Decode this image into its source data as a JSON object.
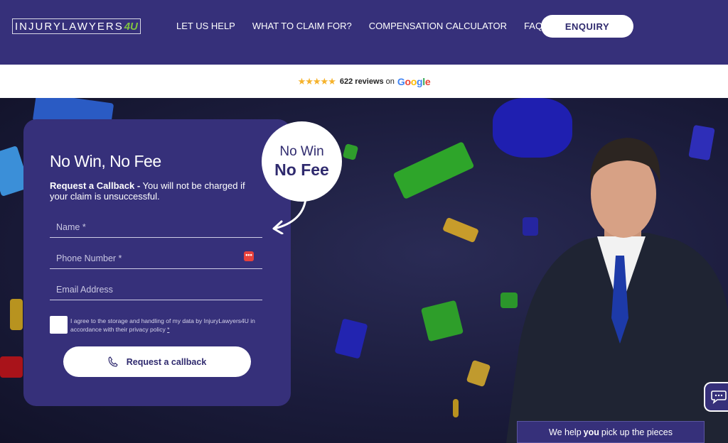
{
  "header": {
    "logo_text": "INJURYLAWYERS",
    "logo_suffix": "4U",
    "nav": [
      "LET US HELP",
      "WHAT TO CLAIM FOR?",
      "COMPENSATION CALCULATOR",
      "FAQ"
    ],
    "enquiry_label": "ENQUIRY"
  },
  "reviews": {
    "stars": "★★★★★",
    "count_text": "622 reviews",
    "on_text": "on",
    "google": [
      "G",
      "o",
      "o",
      "g",
      "l",
      "e"
    ]
  },
  "form": {
    "title": "No Win, No Fee",
    "subtitle_bold": "Request a Callback -",
    "subtitle_rest": " You will not be charged if your claim is unsuccessful.",
    "name_placeholder": "Name *",
    "phone_placeholder": "Phone Number *",
    "email_placeholder": "Email Address",
    "consent_text": "I agree to the storage and handling of my data by InjuryLawyers4U in accordance with their privacy policy",
    "consent_asterisk": "*",
    "callback_label": "Request a callback"
  },
  "bubble": {
    "line1": "No Win",
    "line2": "No Fee"
  },
  "tagline": {
    "pre": "We help",
    "bold": "you",
    "post": "pick up the pieces"
  },
  "colors": {
    "brand": "#36307a",
    "accent_green": "#7fc241",
    "star": "#f5b22b"
  }
}
